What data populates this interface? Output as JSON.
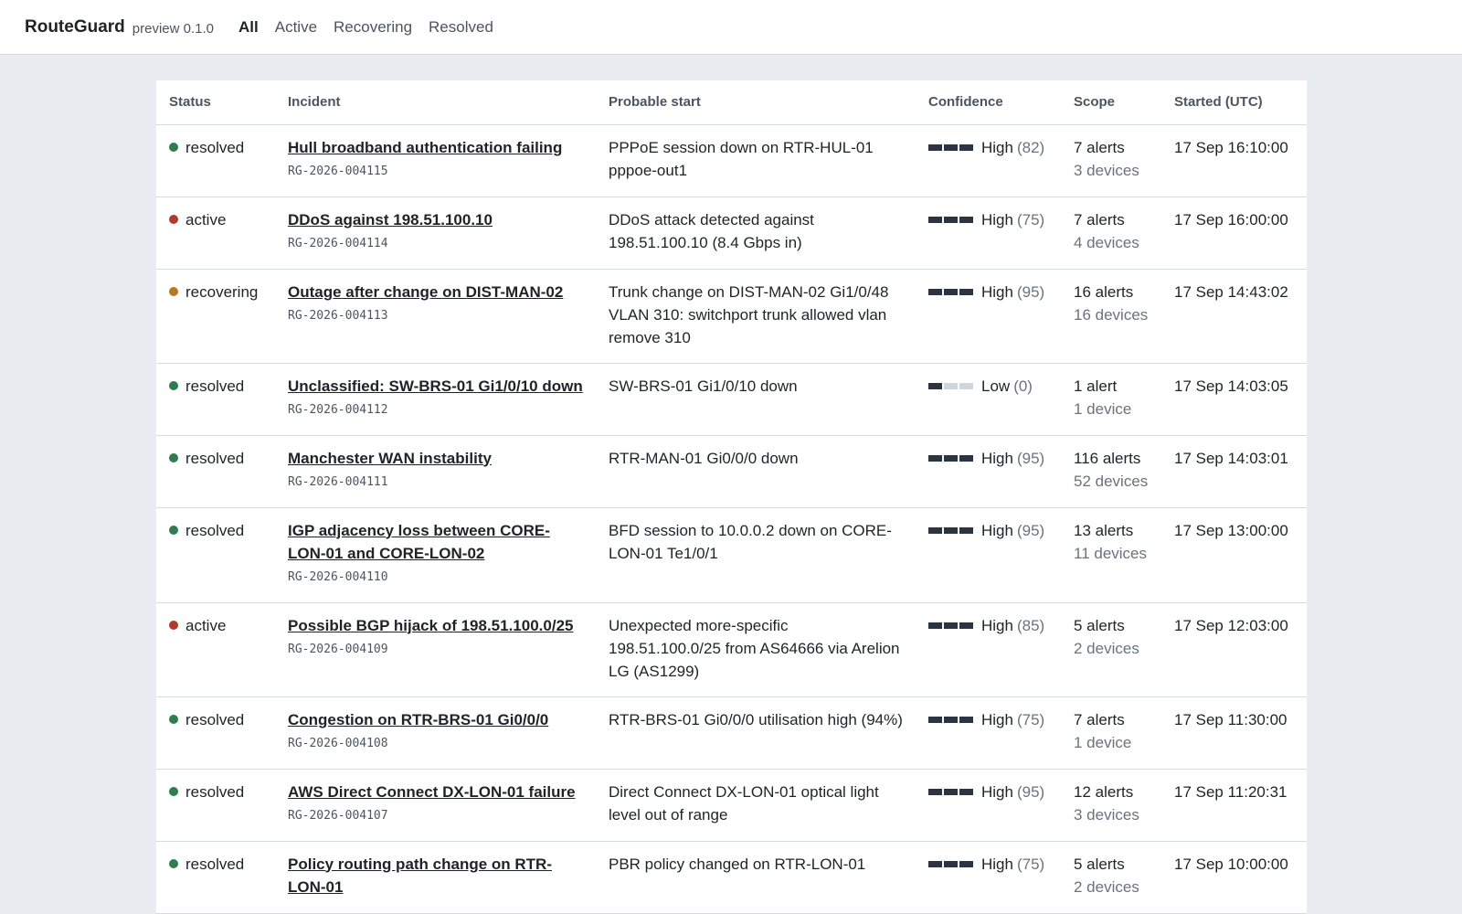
{
  "app": {
    "name": "RouteGuard",
    "version": "preview 0.1.0"
  },
  "tabs": [
    {
      "label": "All",
      "active": true
    },
    {
      "label": "Active",
      "active": false
    },
    {
      "label": "Recovering",
      "active": false
    },
    {
      "label": "Resolved",
      "active": false
    }
  ],
  "table": {
    "headers": {
      "status": "Status",
      "incident": "Incident",
      "start": "Probable start",
      "confidence": "Confidence",
      "scope": "Scope",
      "started": "Started (UTC)"
    },
    "rows": [
      {
        "status": "resolved",
        "title": "Hull broadband authentication failing",
        "id": "RG-2026-004115",
        "probable_start": "PPPoE session down on RTR-HUL-01 pppoe-out1",
        "confidence_level": "High",
        "confidence_score": "(82)",
        "alerts": "7 alerts",
        "devices": "3 devices",
        "started": "17 Sep 16:10:00"
      },
      {
        "status": "active",
        "title": "DDoS against 198.51.100.10",
        "id": "RG-2026-004114",
        "probable_start": "DDoS attack detected against 198.51.100.10 (8.4 Gbps in)",
        "confidence_level": "High",
        "confidence_score": "(75)",
        "alerts": "7 alerts",
        "devices": "4 devices",
        "started": "17 Sep 16:00:00"
      },
      {
        "status": "recovering",
        "title": "Outage after change on DIST-MAN-02",
        "id": "RG-2026-004113",
        "probable_start": "Trunk change on DIST-MAN-02 Gi1/0/48 VLAN 310: switchport trunk allowed vlan remove 310",
        "confidence_level": "High",
        "confidence_score": "(95)",
        "alerts": "16 alerts",
        "devices": "16 devices",
        "started": "17 Sep 14:43:02"
      },
      {
        "status": "resolved",
        "title": "Unclassified: SW-BRS-01 Gi1/0/10 down",
        "id": "RG-2026-004112",
        "probable_start": "SW-BRS-01 Gi1/0/10 down",
        "confidence_level": "Low",
        "confidence_score": "(0)",
        "alerts": "1 alert",
        "devices": "1 device",
        "started": "17 Sep 14:03:05"
      },
      {
        "status": "resolved",
        "title": "Manchester WAN instability",
        "id": "RG-2026-004111",
        "probable_start": "RTR-MAN-01 Gi0/0/0 down",
        "confidence_level": "High",
        "confidence_score": "(95)",
        "alerts": "116 alerts",
        "devices": "52 devices",
        "started": "17 Sep 14:03:01"
      },
      {
        "status": "resolved",
        "title": "IGP adjacency loss between CORE-LON-01 and CORE-LON-02",
        "id": "RG-2026-004110",
        "probable_start": "BFD session to 10.0.0.2 down on CORE-LON-01 Te1/0/1",
        "confidence_level": "High",
        "confidence_score": "(95)",
        "alerts": "13 alerts",
        "devices": "11 devices",
        "started": "17 Sep 13:00:00"
      },
      {
        "status": "active",
        "title": "Possible BGP hijack of 198.51.100.0/25",
        "id": "RG-2026-004109",
        "probable_start": "Unexpected more-specific 198.51.100.0/25 from AS64666 via Arelion LG (AS1299)",
        "confidence_level": "High",
        "confidence_score": "(85)",
        "alerts": "5 alerts",
        "devices": "2 devices",
        "started": "17 Sep 12:03:00"
      },
      {
        "status": "resolved",
        "title": "Congestion on RTR-BRS-01 Gi0/0/0",
        "id": "RG-2026-004108",
        "probable_start": "RTR-BRS-01 Gi0/0/0 utilisation high (94%)",
        "confidence_level": "High",
        "confidence_score": "(75)",
        "alerts": "7 alerts",
        "devices": "1 device",
        "started": "17 Sep 11:30:00"
      },
      {
        "status": "resolved",
        "title": "AWS Direct Connect DX-LON-01 failure",
        "id": "RG-2026-004107",
        "probable_start": "Direct Connect DX-LON-01 optical light level out of range",
        "confidence_level": "High",
        "confidence_score": "(95)",
        "alerts": "12 alerts",
        "devices": "3 devices",
        "started": "17 Sep 11:20:31"
      },
      {
        "status": "resolved",
        "title": "Policy routing path change on RTR-LON-01",
        "id": "",
        "probable_start": "PBR policy changed on RTR-LON-01",
        "confidence_level": "High",
        "confidence_score": "(75)",
        "alerts": "5 alerts",
        "devices": "2 devices",
        "started": "17 Sep 10:00:00"
      }
    ]
  },
  "colors": {
    "resolved": "#2e7d4f",
    "active": "#b23a2b",
    "recovering": "#b7791f",
    "bar_filled": "#2b3440",
    "bar_empty": "#cfd6de"
  }
}
